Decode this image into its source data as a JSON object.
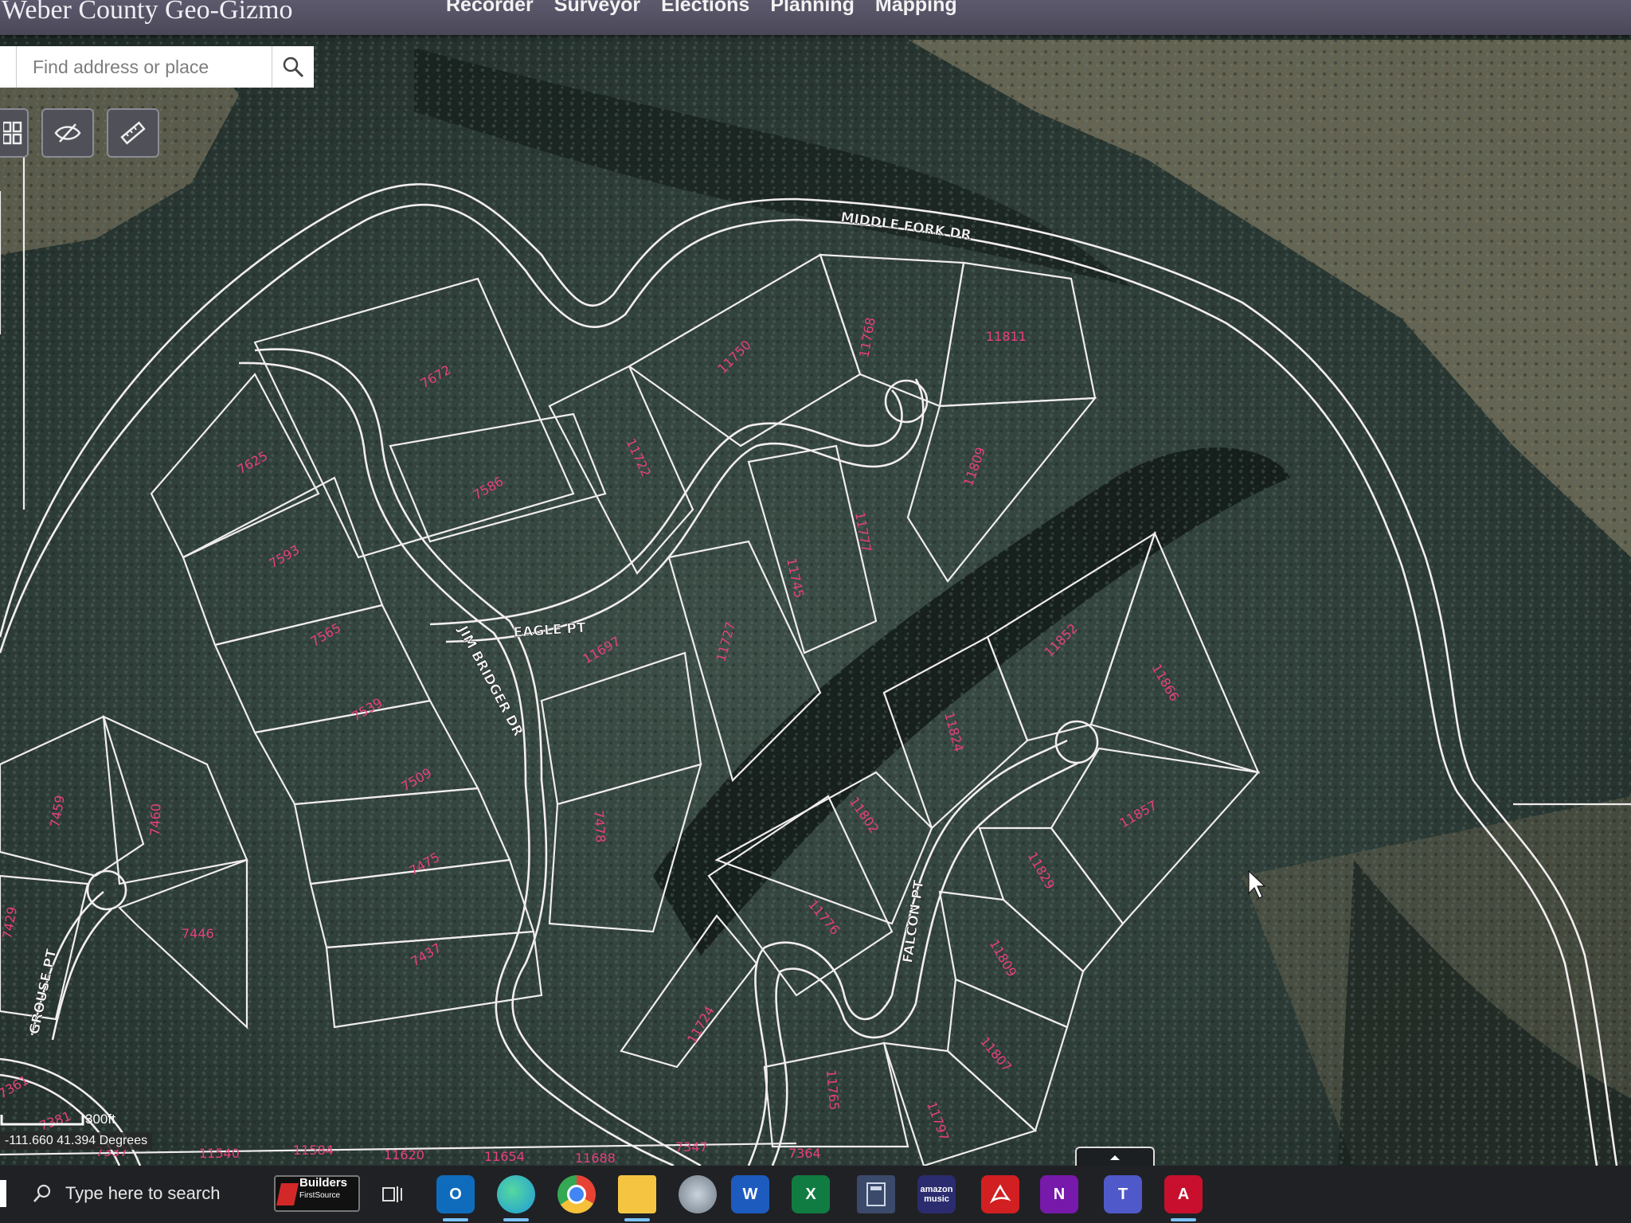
{
  "header": {
    "app_title": "Weber County Geo-Gizmo",
    "nav": [
      "Recorder",
      "Surveyor",
      "Elections",
      "Planning",
      "Mapping"
    ]
  },
  "search": {
    "placeholder": "Find address or place"
  },
  "tools": [
    "basemap-gallery",
    "layer-visibility",
    "measure"
  ],
  "map": {
    "roads": [
      "MIDDLE FORK DR",
      "EAGLE PT",
      "JIM BRIDGER DR",
      "FALCON PT",
      "GROUSE PT"
    ],
    "parcels": [
      "7672",
      "7625",
      "7586",
      "7593",
      "7565",
      "7539",
      "7509",
      "7475",
      "7437",
      "7478",
      "7459",
      "7460",
      "7446",
      "11750",
      "11768",
      "11811",
      "11722",
      "11809",
      "11777",
      "11745",
      "11727",
      "11697",
      "11852",
      "11866",
      "11824",
      "11857",
      "11802",
      "11829",
      "11776",
      "11809",
      "11807",
      "11724",
      "11765",
      "11797",
      "7381",
      "7361",
      "7429",
      "7337",
      "11540",
      "11584",
      "11620",
      "11654",
      "11688",
      "7347",
      "7364"
    ],
    "scale_label": "300ft",
    "coordinates": "-111.660 41.394 Degrees",
    "colors": {
      "parcel_line": "#f4f0f0",
      "parcel_label": "#e8407e"
    }
  },
  "taskbar": {
    "search_text": "Type here to search",
    "pinned": [
      {
        "name": "builders-firstsource",
        "label": "Builders",
        "sub": "FirstSource"
      },
      {
        "name": "task-view",
        "label": ""
      },
      {
        "name": "outlook",
        "label": "O",
        "color": "#0f6cbd"
      },
      {
        "name": "edge",
        "label": "",
        "color": "#1e9bd7"
      },
      {
        "name": "chrome",
        "label": "",
        "color": "#e84235"
      },
      {
        "name": "file-explorer",
        "label": "",
        "color": "#f5c542"
      },
      {
        "name": "photos",
        "label": "",
        "color": "#6f7a86"
      },
      {
        "name": "word",
        "label": "W",
        "color": "#1e5bbf"
      },
      {
        "name": "excel",
        "label": "X",
        "color": "#107c41"
      },
      {
        "name": "calculator",
        "label": "",
        "color": "#3b4a6b"
      },
      {
        "name": "amazon-music",
        "label": "amazon music",
        "color": "#2b2c6f"
      },
      {
        "name": "acrobat",
        "label": "",
        "color": "#d21f21"
      },
      {
        "name": "onenote",
        "label": "N",
        "color": "#7719aa"
      },
      {
        "name": "teams",
        "label": "T",
        "color": "#5059c9"
      },
      {
        "name": "autocad",
        "label": "A",
        "color": "#c8102e"
      }
    ]
  }
}
